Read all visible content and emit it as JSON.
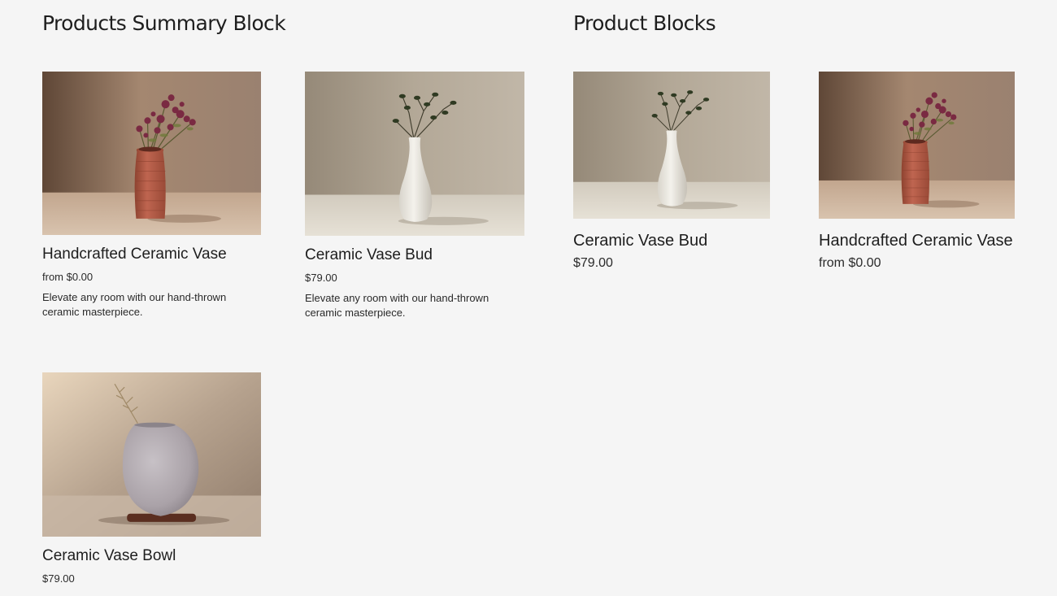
{
  "summary_section": {
    "title": "Products Summary Block",
    "products": [
      {
        "image": "terracotta-vase-image",
        "name": "Handcrafted Ceramic Vase",
        "price": "from $0.00",
        "description": "Elevate any room with our hand-thrown ceramic masterpiece."
      },
      {
        "image": "white-bud-vase-image",
        "name": "Ceramic Vase Bud",
        "price": "$79.00",
        "description": "Elevate any room with our hand-thrown ceramic masterpiece."
      },
      {
        "image": "gray-bowl-vase-image",
        "name": "Ceramic Vase Bowl",
        "price": "$79.00"
      }
    ]
  },
  "blocks_section": {
    "title": "Product Blocks",
    "products": [
      {
        "image": "white-bud-vase-image",
        "name": "Ceramic Vase Bud",
        "price": "$79.00"
      },
      {
        "image": "terracotta-vase-image",
        "name": "Handcrafted Ceramic Vase",
        "price": "from $0.00"
      }
    ]
  },
  "colors": {
    "page_background": "#f5f5f5",
    "text": "#1e1e1e",
    "terracotta": "#b35a44",
    "porcelain": "#ece9e2",
    "stoneware": "#b4adb2"
  }
}
